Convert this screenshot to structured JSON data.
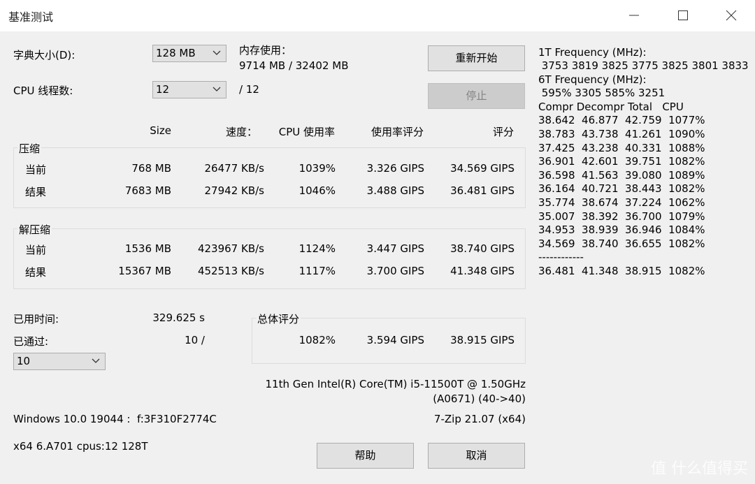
{
  "window": {
    "title": "基准测试"
  },
  "controls": {
    "dict_label": "字典大小(D):",
    "dict_value": "128 MB",
    "threads_label": "CPU 线程数:",
    "threads_value": "12",
    "threads_total": "/ 12",
    "mem_label": "内存使用：",
    "mem_value": "9714 MB / 32402 MB",
    "restart_label": "重新开始",
    "stop_label": "停止"
  },
  "table": {
    "headers": [
      "Size",
      "速度：",
      "CPU 使用率",
      "使用率评分",
      "评分"
    ],
    "compress": {
      "label": "压缩",
      "rows": [
        {
          "name": "当前",
          "size": "768 MB",
          "speed": "26477 KB/s",
          "cpu": "1039%",
          "usage": "3.326 GIPS",
          "score": "34.569 GIPS"
        },
        {
          "name": "结果",
          "size": "7683 MB",
          "speed": "27942 KB/s",
          "cpu": "1046%",
          "usage": "3.488 GIPS",
          "score": "36.481 GIPS"
        }
      ]
    },
    "decompress": {
      "label": "解压缩",
      "rows": [
        {
          "name": "当前",
          "size": "1536 MB",
          "speed": "423967 KB/s",
          "cpu": "1124%",
          "usage": "3.447 GIPS",
          "score": "38.740 GIPS"
        },
        {
          "name": "结果",
          "size": "15367 MB",
          "speed": "452513 KB/s",
          "cpu": "1117%",
          "usage": "3.700 GIPS",
          "score": "41.348 GIPS"
        }
      ]
    }
  },
  "status": {
    "elapsed_label": "已用时间:",
    "elapsed_value": "329.625 s",
    "passed_label": "已通过:",
    "passed_value": "10 /",
    "passes_value": "10"
  },
  "total": {
    "label": "总体评分",
    "cpu": "1082%",
    "usage": "3.594 GIPS",
    "score": "38.915 GIPS"
  },
  "sysinfo": {
    "cpu_name": "11th Gen Intel(R) Core(TM) i5-11500T @ 1.50GHz",
    "cpu_id": "(A0671) (40->40)",
    "os": "Windows 10.0 19044 :  f:3F310F2774C",
    "app_version": "7-Zip 21.07 (x64)",
    "arch": "x64 6.A701 cpus:12 128T"
  },
  "bottom": {
    "help_label": "帮助",
    "cancel_label": "取消"
  },
  "log": {
    "lines": [
      "1T Frequency (MHz):",
      " 3753 3819 3825 3775 3825 3801 3833",
      "6T Frequency (MHz):",
      " 595% 3305 585% 3251",
      "Compr Decompr Total   CPU",
      "38.642  46.877  42.759  1077%",
      "38.783  43.738  41.261  1090%",
      "37.425  43.238  40.331  1088%",
      "36.901  42.601  39.751  1082%",
      "36.598  41.563  39.080  1089%",
      "36.164  40.721  38.443  1082%",
      "35.774  38.674  37.224  1062%",
      "35.007  38.392  36.700  1079%",
      "34.953  38.939  36.946  1084%",
      "34.569  38.740  36.655  1082%",
      "------------",
      "36.481  41.348  38.915  1082%"
    ]
  },
  "watermark": "值 什么值得买"
}
